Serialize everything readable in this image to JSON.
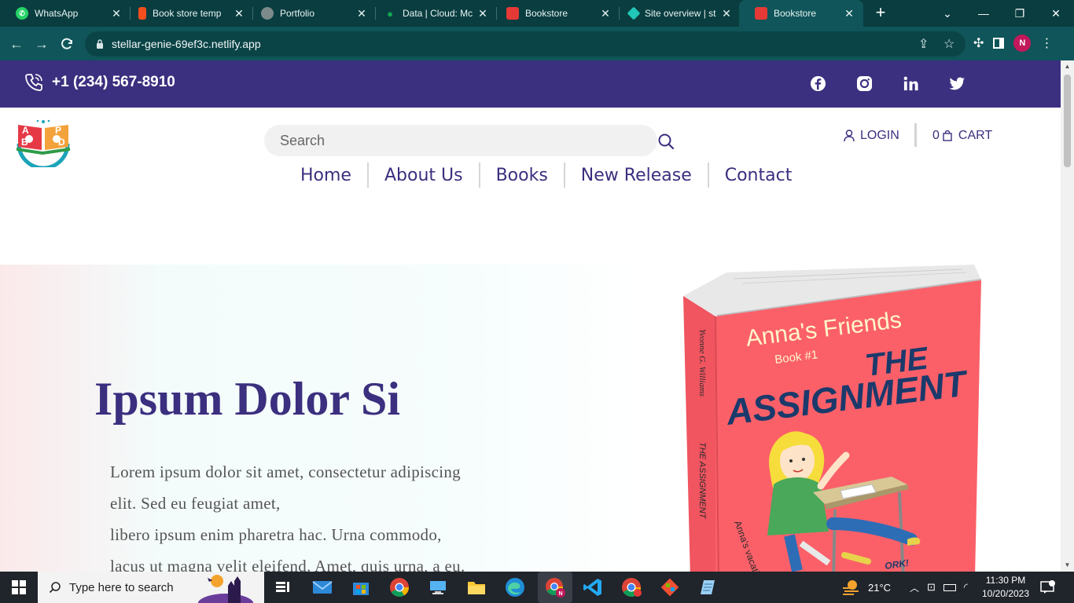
{
  "browser": {
    "tabs": [
      {
        "title": "WhatsApp",
        "icon": "whatsapp-icon",
        "color": "#25d366"
      },
      {
        "title": "Book store temp",
        "icon": "figma-icon",
        "color": "#f24e1e"
      },
      {
        "title": "Portfolio",
        "icon": "globe-icon",
        "color": "#7c8a8c"
      },
      {
        "title": "Data | Cloud: Mc",
        "icon": "mongodb-icon",
        "color": "#13aa52"
      },
      {
        "title": "Bookstore",
        "icon": "bookstore-icon",
        "color": "#e53935"
      },
      {
        "title": "Site overview | st",
        "icon": "netlify-icon",
        "color": "#20c6b7"
      },
      {
        "title": "Bookstore",
        "icon": "bookstore-icon",
        "color": "#e53935"
      }
    ],
    "url": "stellar-genie-69ef3c.netlify.app",
    "profile_initial": "N"
  },
  "site": {
    "phone": "+1 (234) 567-8910",
    "socials": [
      "facebook-icon",
      "instagram-icon",
      "linkedin-icon",
      "twitter-icon"
    ],
    "search_placeholder": "Search",
    "login_label": "LOGIN",
    "cart_count": "0",
    "cart_label": "CART",
    "nav": [
      "Home",
      "About Us",
      "Books",
      "New Release",
      "Contact"
    ],
    "hero": {
      "title": "Ipsum Dolor Si",
      "text_lines": [
        "Lorem ipsum dolor sit amet, consectetur adipiscing",
        "elit. Sed eu feugiat amet,",
        "libero ipsum enim pharetra hac. Urna commodo,",
        "lacus ut magna velit eleifend. Amet, quis urna, a eu."
      ],
      "book": {
        "series": "Anna's Friends",
        "book_no": "Book #1",
        "title_1": "THE",
        "title_2": "ASSIGNMENT",
        "author_spine": "Yvonne G. Williams",
        "title_spine": "THE ASSIGNMENT",
        "cover_partial": "Anna's vacatio",
        "cover_partial_2": "ORK!"
      }
    },
    "logo_letters": [
      "A",
      "B",
      "P",
      "D"
    ]
  },
  "taskbar": {
    "search_placeholder": "Type here to search",
    "weather": "21°C",
    "time": "11:30 PM",
    "date": "10/20/2023"
  }
}
